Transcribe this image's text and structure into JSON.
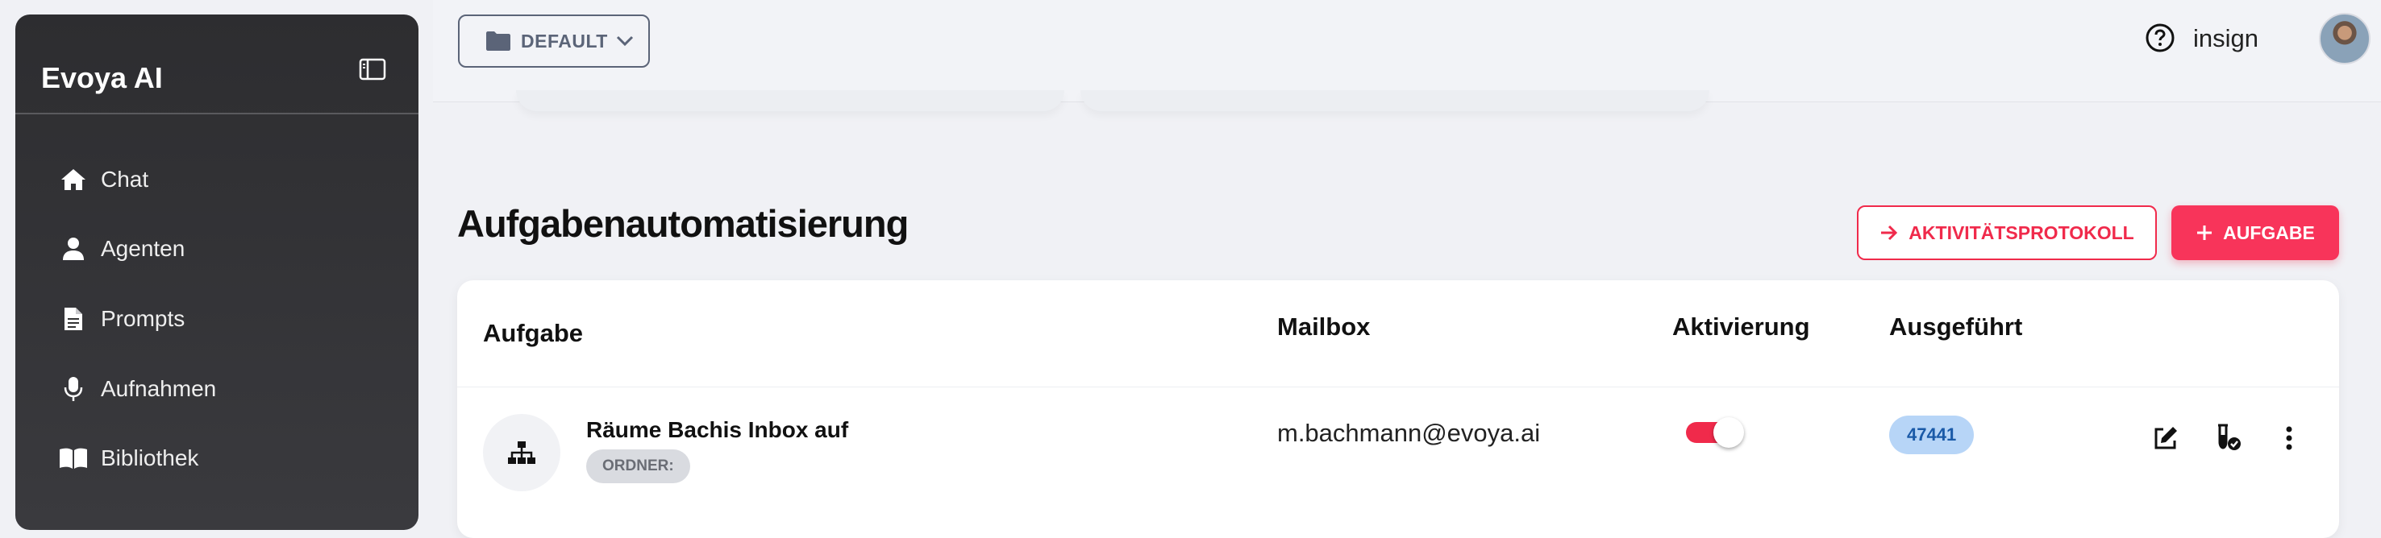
{
  "sidebar": {
    "brand": "Evoya AI",
    "items": [
      {
        "label": "Chat",
        "icon": "home-icon"
      },
      {
        "label": "Agenten",
        "icon": "person-icon"
      },
      {
        "label": "Prompts",
        "icon": "document-icon"
      },
      {
        "label": "Aufnahmen",
        "icon": "microphone-icon"
      },
      {
        "label": "Bibliothek",
        "icon": "book-icon"
      }
    ]
  },
  "topbar": {
    "workspace_label": "DEFAULT",
    "user_name": "insign"
  },
  "main": {
    "title": "Aufgabenautomatisierung",
    "activity_log_button": "AKTIVITÄTSPROTOKOLL",
    "add_task_button": "AUFGABE",
    "table": {
      "headers": {
        "task": "Aufgabe",
        "mailbox": "Mailbox",
        "activation": "Aktivierung",
        "executed": "Ausgeführt"
      },
      "rows": [
        {
          "name": "Räume Bachis Inbox auf",
          "tag": "ORDNER:",
          "mailbox": "m.bachmann@evoya.ai",
          "active": true,
          "executed": "47441"
        }
      ]
    }
  },
  "colors": {
    "accent": "#f02a4b",
    "badge_bg": "#b7d5f7",
    "badge_text": "#1a5aa8",
    "sidebar_bg": "#2d2d30"
  }
}
